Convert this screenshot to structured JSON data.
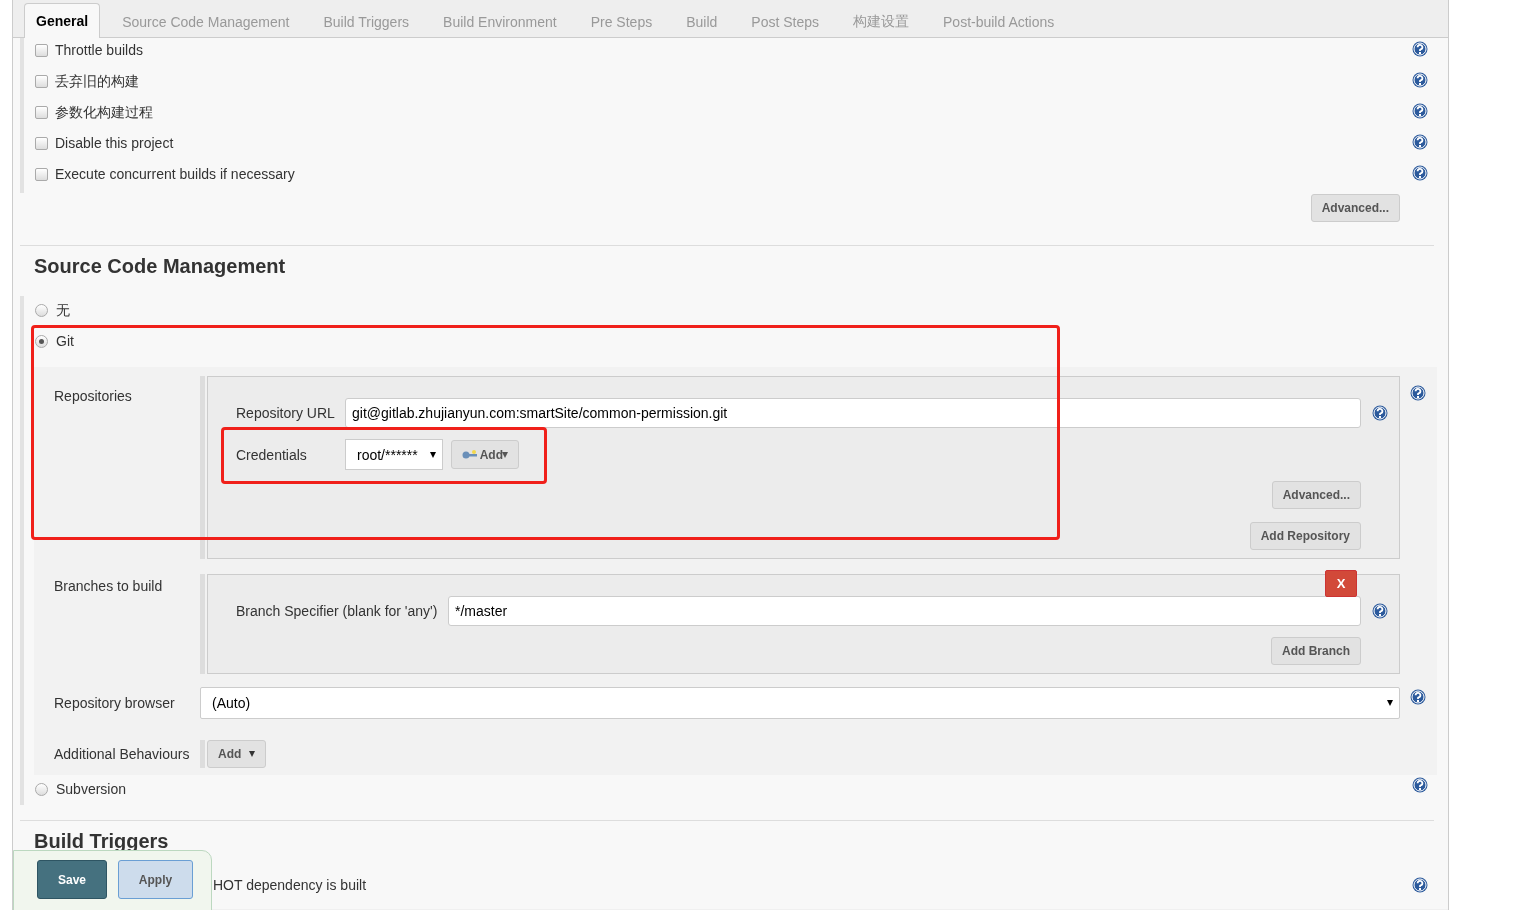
{
  "tabs": [
    {
      "label": "General",
      "selected": true
    },
    {
      "label": "Source Code Management",
      "selected": false
    },
    {
      "label": "Build Triggers",
      "selected": false
    },
    {
      "label": "Build Environment",
      "selected": false
    },
    {
      "label": "Pre Steps",
      "selected": false
    },
    {
      "label": "Build",
      "selected": false
    },
    {
      "label": "Post Steps",
      "selected": false
    },
    {
      "label": "构建设置",
      "selected": false
    },
    {
      "label": "Post-build Actions",
      "selected": false
    }
  ],
  "general": {
    "options": [
      {
        "label": "Throttle builds",
        "checked": false
      },
      {
        "label": "丢弃旧的构建",
        "checked": false
      },
      {
        "label": "参数化构建过程",
        "checked": false
      },
      {
        "label": "Disable this project",
        "checked": false
      },
      {
        "label": "Execute concurrent builds if necessary",
        "checked": false
      }
    ],
    "advanced_button": "Advanced..."
  },
  "scm": {
    "title": "Source Code Management",
    "options": [
      {
        "label": "无",
        "selected": false
      },
      {
        "label": "Git",
        "selected": true
      },
      {
        "label": "Subversion",
        "selected": false
      }
    ],
    "git": {
      "repositories_label": "Repositories",
      "repository_url_label": "Repository URL",
      "repository_url": "git@gitlab.zhujianyun.com:smartSite/common-permission.git",
      "credentials_label": "Credentials",
      "credentials_value": "root/******",
      "add_credentials_button": "Add",
      "advanced_button": "Advanced...",
      "add_repository_button": "Add Repository",
      "branches_label": "Branches to build",
      "delete_branch_button": "X",
      "branch_specifier_label": "Branch Specifier (blank for 'any')",
      "branch_specifier": "*/master",
      "add_branch_button": "Add Branch",
      "repository_browser_label": "Repository browser",
      "repository_browser": "(Auto)",
      "additional_behaviours_label": "Additional Behaviours",
      "add_behaviour_button": "Add"
    }
  },
  "build_triggers": {
    "title": "Build Triggers",
    "option_text": "HOT dependency is built"
  },
  "save_bar": {
    "save_button": "Save",
    "apply_button": "Apply"
  }
}
